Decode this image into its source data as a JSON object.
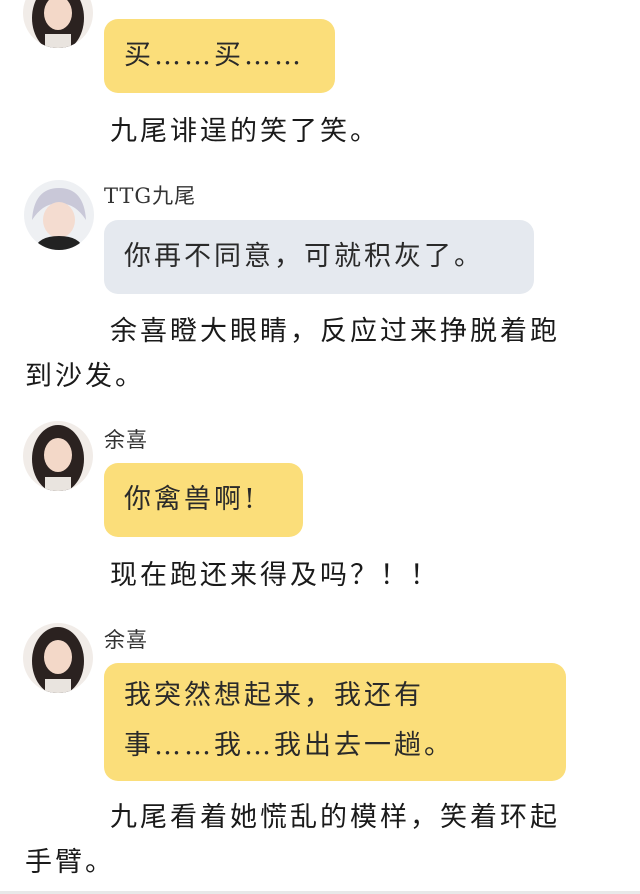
{
  "messages": [
    {
      "text": "买……买……"
    },
    {
      "narration": "九尾诽逞的笑了笑。"
    },
    {
      "sender": "TTG九尾",
      "text": "你再不同意，可就积灰了。"
    },
    {
      "narration": "余喜瞪大眼睛，反应过来挣脱着跑到沙发。"
    },
    {
      "sender": "余喜",
      "text": "你禽兽啊!"
    },
    {
      "narration": "现在跑还来得及吗？！！"
    },
    {
      "sender": "余喜",
      "text_line1": "我突然想起来，我还有",
      "text_line2": "事……我…我出去一趟。"
    },
    {
      "narration": "九尾看着她慌乱的模样，笑着环起手臂。"
    }
  ],
  "narration_lines": {
    "line1a": "余喜瞪大眼睛，反应过来挣脱着跑",
    "line1b": "到沙发。",
    "line2a": "九尾看着她慌乱的模样，笑着环起",
    "line2b": "手臂。"
  },
  "colors": {
    "yellow_bubble": "#fbde7a",
    "blue_bubble": "#e5e9ef"
  }
}
